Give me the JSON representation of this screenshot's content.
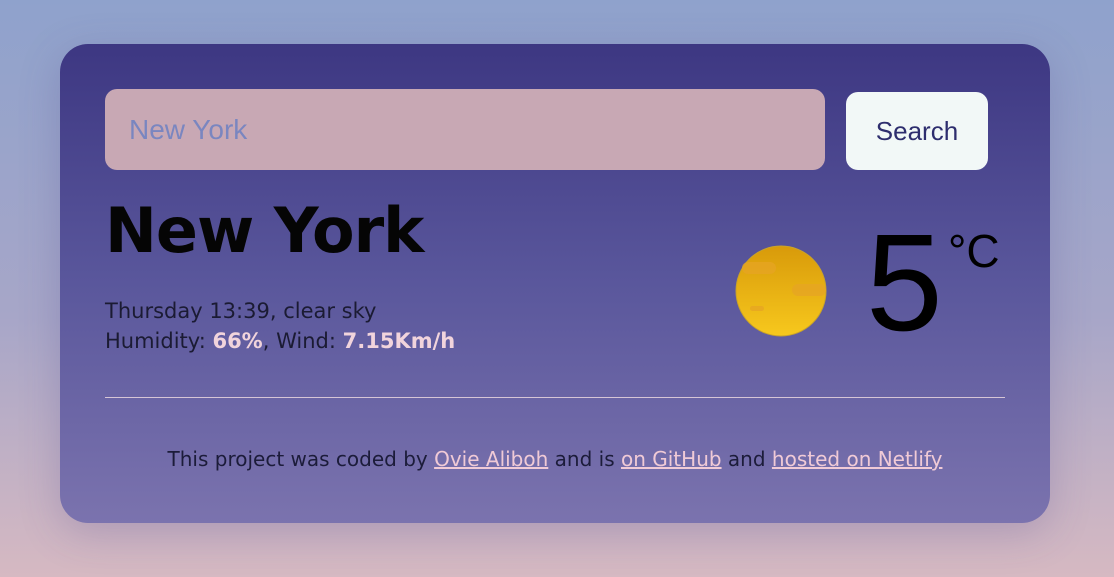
{
  "search": {
    "placeholder": "New York",
    "button_label": "Search"
  },
  "weather": {
    "city": "New York",
    "day_time": "Thursday 13:39",
    "description": "clear sky",
    "humidity_label": "Humidity:",
    "humidity_value": "66%",
    "wind_label": "Wind:",
    "wind_value": "7.15Km/h",
    "temperature": "5",
    "unit": "°C",
    "icon": "sun-icon"
  },
  "footer": {
    "prefix": "This project was coded by",
    "author_link": "Ovie Aliboh",
    "middle": "and is",
    "github_link": "on GitHub",
    "and": "and",
    "netlify_link": "hosted on Netlify"
  },
  "colors": {
    "card_top": "#3d3782",
    "card_bottom": "#7b73ae",
    "input_bg": "#c8a8b4",
    "button_bg": "#f2f8f7",
    "accent_text": "#f0cad6"
  }
}
